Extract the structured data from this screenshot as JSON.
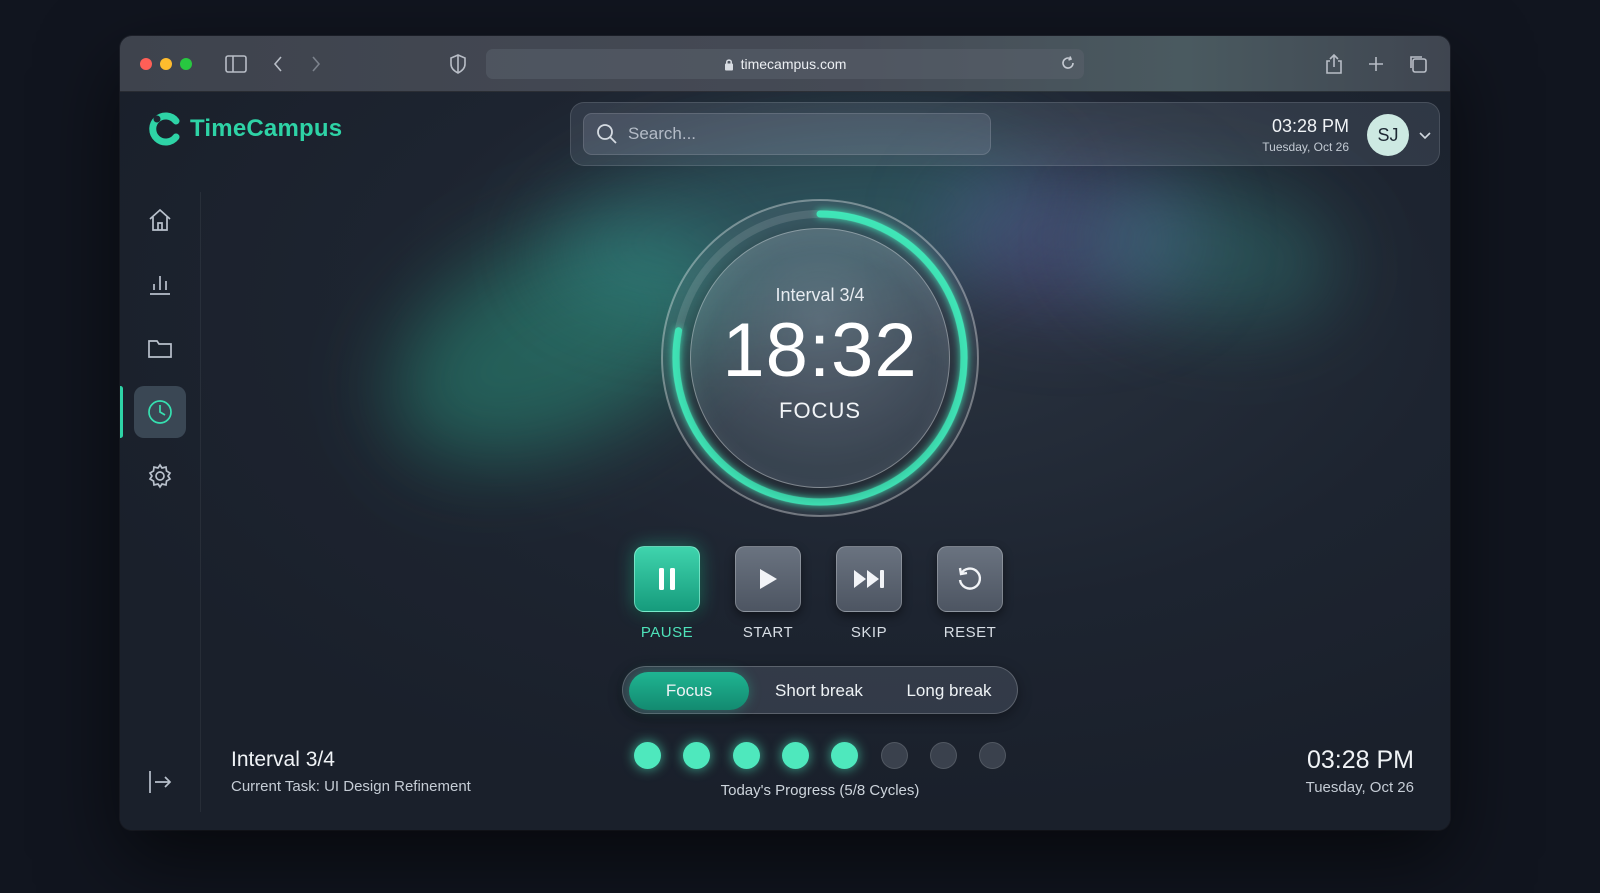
{
  "browser": {
    "url": "timecampus.com"
  },
  "app": {
    "name": "TimeCampus",
    "accent": "#2ed3a6"
  },
  "sidebar": {
    "items": [
      {
        "name": "home",
        "icon": "home-icon",
        "active": false
      },
      {
        "name": "stats",
        "icon": "bar-chart-icon",
        "active": false
      },
      {
        "name": "projects",
        "icon": "folder-icon",
        "active": false
      },
      {
        "name": "timer",
        "icon": "clock-icon",
        "active": true
      },
      {
        "name": "settings",
        "icon": "gear-icon",
        "active": false
      }
    ],
    "logout_icon": "logout-icon"
  },
  "topbar": {
    "search_placeholder": "Search...",
    "time": "03:28 PM",
    "date": "Tuesday, Oct 26",
    "avatar_initials": "SJ"
  },
  "timer": {
    "interval": "Interval 3/4",
    "time": "18:32",
    "mode": "FOCUS",
    "ring_progress": 0.78
  },
  "controls": [
    {
      "label": "PAUSE",
      "icon": "pause-icon",
      "primary": true
    },
    {
      "label": "START",
      "icon": "play-icon",
      "primary": false
    },
    {
      "label": "SKIP",
      "icon": "skip-forward-icon",
      "primary": false
    },
    {
      "label": "RESET",
      "icon": "reset-icon",
      "primary": false
    }
  ],
  "modes": {
    "focus": "Focus",
    "short_break": "Short break",
    "long_break": "Long break",
    "selected": "Focus"
  },
  "progress": {
    "completed": 5,
    "total": 8,
    "label": "Today's Progress (5/8 Cycles)"
  },
  "footer": {
    "interval": "Interval 3/4",
    "task": "Current Task: UI Design Refinement",
    "time": "03:28 PM",
    "date": "Tuesday, Oct 26"
  }
}
